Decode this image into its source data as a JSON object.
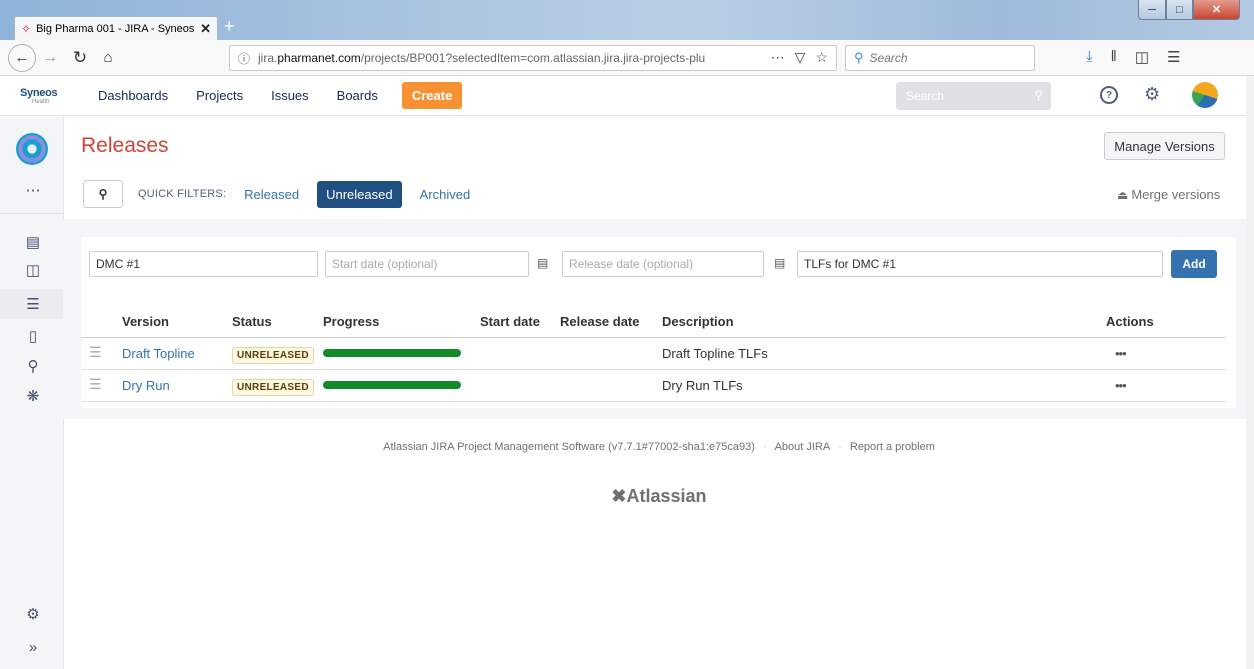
{
  "browser": {
    "tab_title": "Big Pharma 001 - JIRA - Syneos",
    "url_prefix": "jira.",
    "url_domain": "pharmanet.com",
    "url_rest": "/projects/BP001?selectedItem=com.atlassian.jira.jira-projects-plu",
    "search_placeholder": "Search"
  },
  "header": {
    "logo_text": "Syneos",
    "logo_sub": "Health",
    "nav": [
      "Dashboards",
      "Projects",
      "Issues",
      "Boards"
    ],
    "create_label": "Create",
    "search_placeholder": "Search",
    "help_symbol": "?"
  },
  "page": {
    "title": "Releases",
    "manage_versions": "Manage Versions",
    "quick_filters_label": "QUICK FILTERS:",
    "filters": [
      "Released",
      "Unreleased",
      "Archived"
    ],
    "active_filter": "Unreleased",
    "merge_versions": "Merge versions"
  },
  "form": {
    "version_value": "DMC #1",
    "start_placeholder": "Start date (optional)",
    "release_placeholder": "Release date (optional)",
    "description_value": "TLFs for DMC #1",
    "add_label": "Add"
  },
  "table": {
    "columns": {
      "version": "Version",
      "status": "Status",
      "progress": "Progress",
      "start_date": "Start date",
      "release_date": "Release date",
      "description": "Description",
      "actions": "Actions"
    },
    "rows": [
      {
        "version": "Draft Topline",
        "status": "UNRELEASED",
        "progress": 1.0,
        "start_date": "",
        "release_date": "",
        "description": "Draft Topline TLFs",
        "actions": "•••"
      },
      {
        "version": "Dry Run",
        "status": "UNRELEASED",
        "progress": 1.0,
        "start_date": "",
        "release_date": "",
        "description": "Dry Run TLFs",
        "actions": "•••"
      }
    ]
  },
  "footer": {
    "software": "Atlassian JIRA Project Management Software (v7.7.1#77002-sha1:e75ca93)",
    "about": "About JIRA",
    "report": "Report a problem",
    "logo": "Atlassian"
  },
  "colors": {
    "title": "#d04437",
    "link": "#3572b0",
    "create": "#f79232",
    "active_filter": "#205081",
    "progress_done": "#14892c"
  }
}
